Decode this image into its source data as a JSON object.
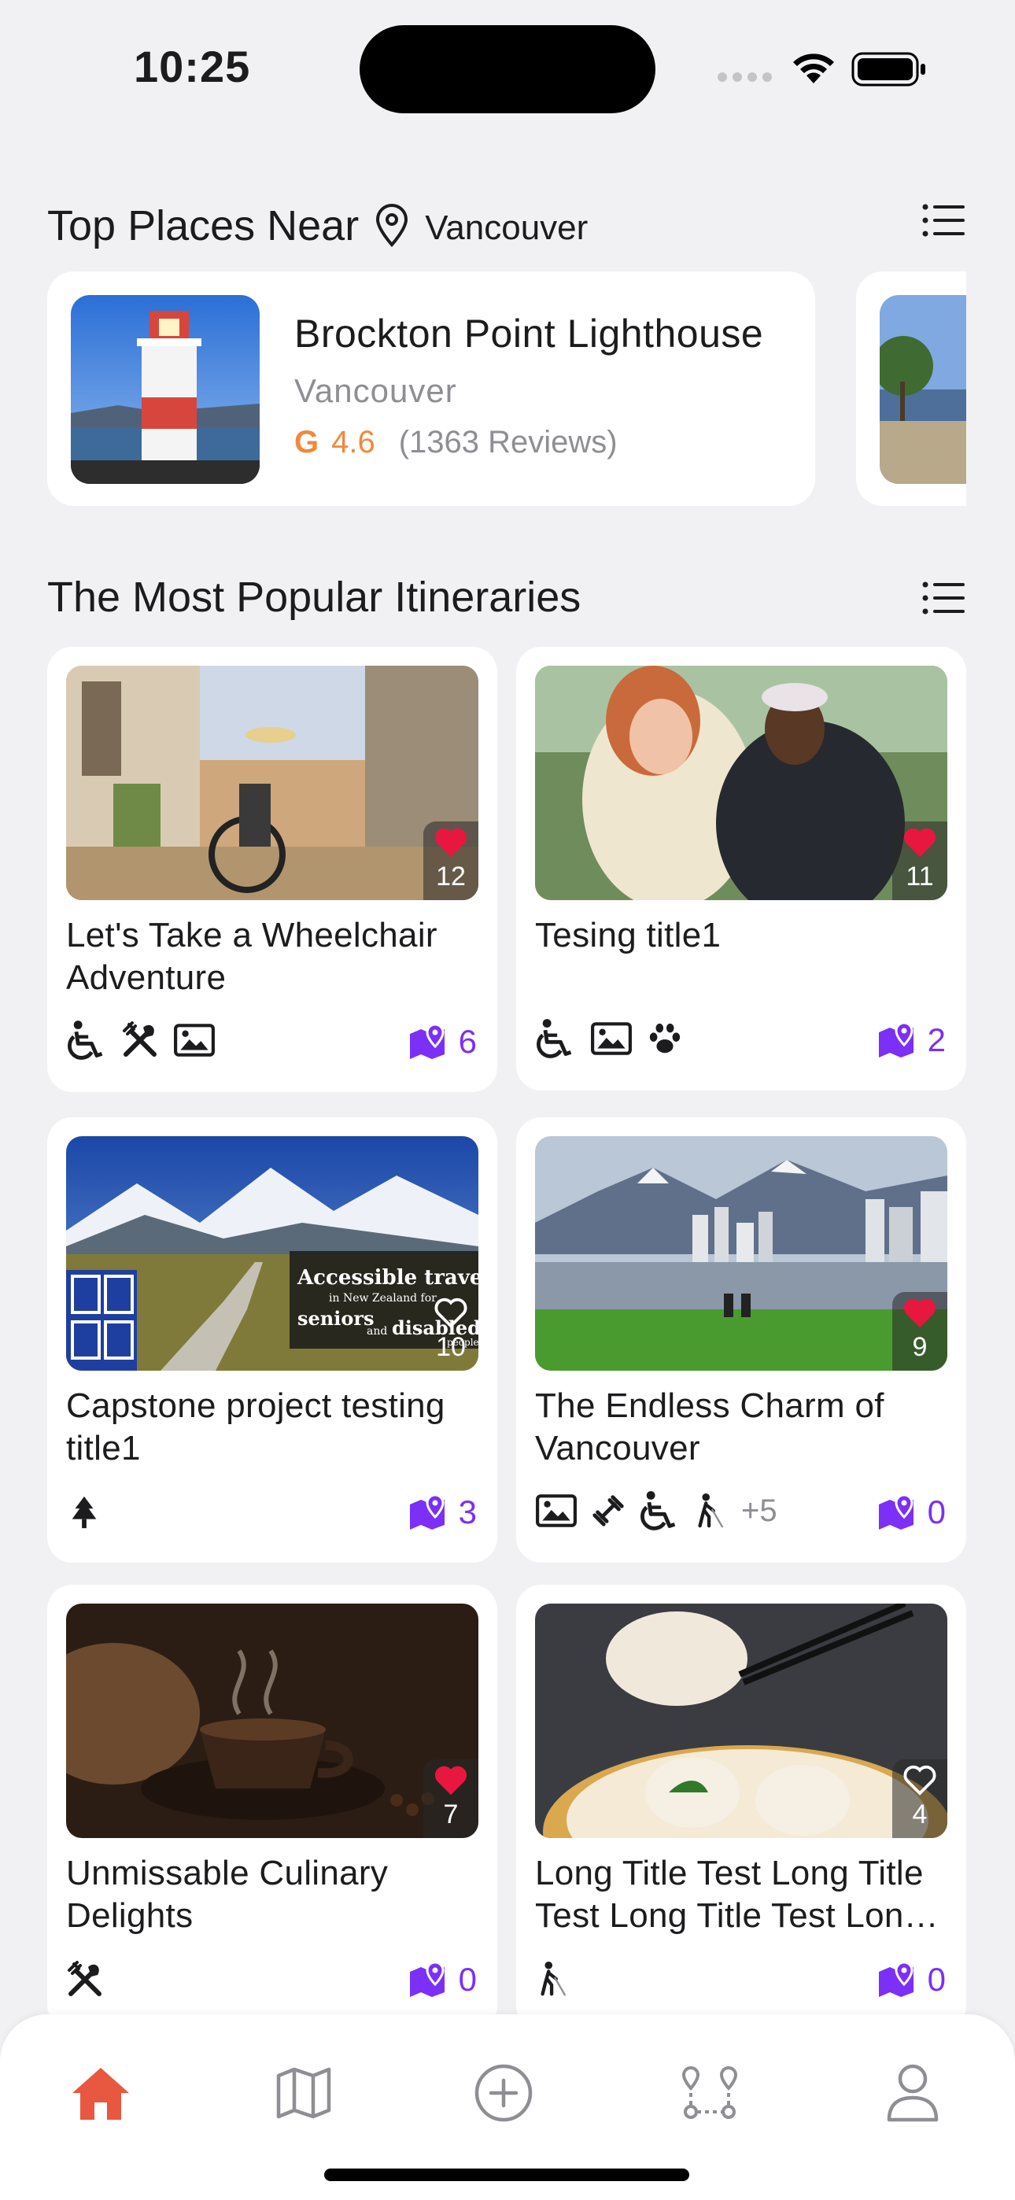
{
  "status_bar": {
    "time": "10:25"
  },
  "places_section": {
    "title": "Top Places Near",
    "location": "Vancouver",
    "places": [
      {
        "name": "Brockton Point Lighthouse",
        "city": "Vancouver",
        "rating_source": "G",
        "rating": "4.6",
        "reviews": "(1363 Reviews)"
      }
    ]
  },
  "itineraries_section": {
    "title": "The Most Popular Itineraries",
    "cards": [
      {
        "title": "Let's Take a Wheelchair Adventure",
        "likes": "12",
        "liked": true,
        "stops": "6",
        "tags": [
          "wheelchair-icon",
          "utensils-icon",
          "image-icon"
        ]
      },
      {
        "title": "Tesing title1",
        "likes": "11",
        "liked": true,
        "stops": "2",
        "tags": [
          "wheelchair-icon",
          "image-icon",
          "paw-icon"
        ]
      },
      {
        "title": "Capstone project testing title1",
        "likes": "10",
        "liked": false,
        "stops": "3",
        "tags": [
          "tree-icon"
        ],
        "image_overlay": {
          "line1": "Accessible travel",
          "line2": "in New Zealand for",
          "line3": "seniors",
          "line4": "and",
          "line5": "disabled",
          "line6": "people"
        }
      },
      {
        "title": "The Endless Charm of Vancouver",
        "likes": "9",
        "liked": true,
        "stops": "0",
        "tags": [
          "image-icon",
          "dumbbell-icon",
          "wheelchair-icon",
          "blind-icon"
        ],
        "more_tags": "+5"
      },
      {
        "title": "Unmissable Culinary Delights",
        "likes": "7",
        "liked": true,
        "stops": "0",
        "tags": [
          "utensils-icon"
        ]
      },
      {
        "title": "Long Title Test Long Title Test Long Title Test Lon…",
        "likes": "4",
        "liked": false,
        "stops": "0",
        "tags": [
          "blind-icon"
        ]
      }
    ]
  },
  "bottom_nav": {
    "items": [
      "home",
      "map",
      "create",
      "route",
      "profile"
    ],
    "active": "home"
  },
  "colors": {
    "accent": "#7b2ff7",
    "rating": "#f0893a",
    "heart": "#e8173f",
    "home_active": "#e8573f",
    "nav_inactive": "#8e8e93"
  }
}
